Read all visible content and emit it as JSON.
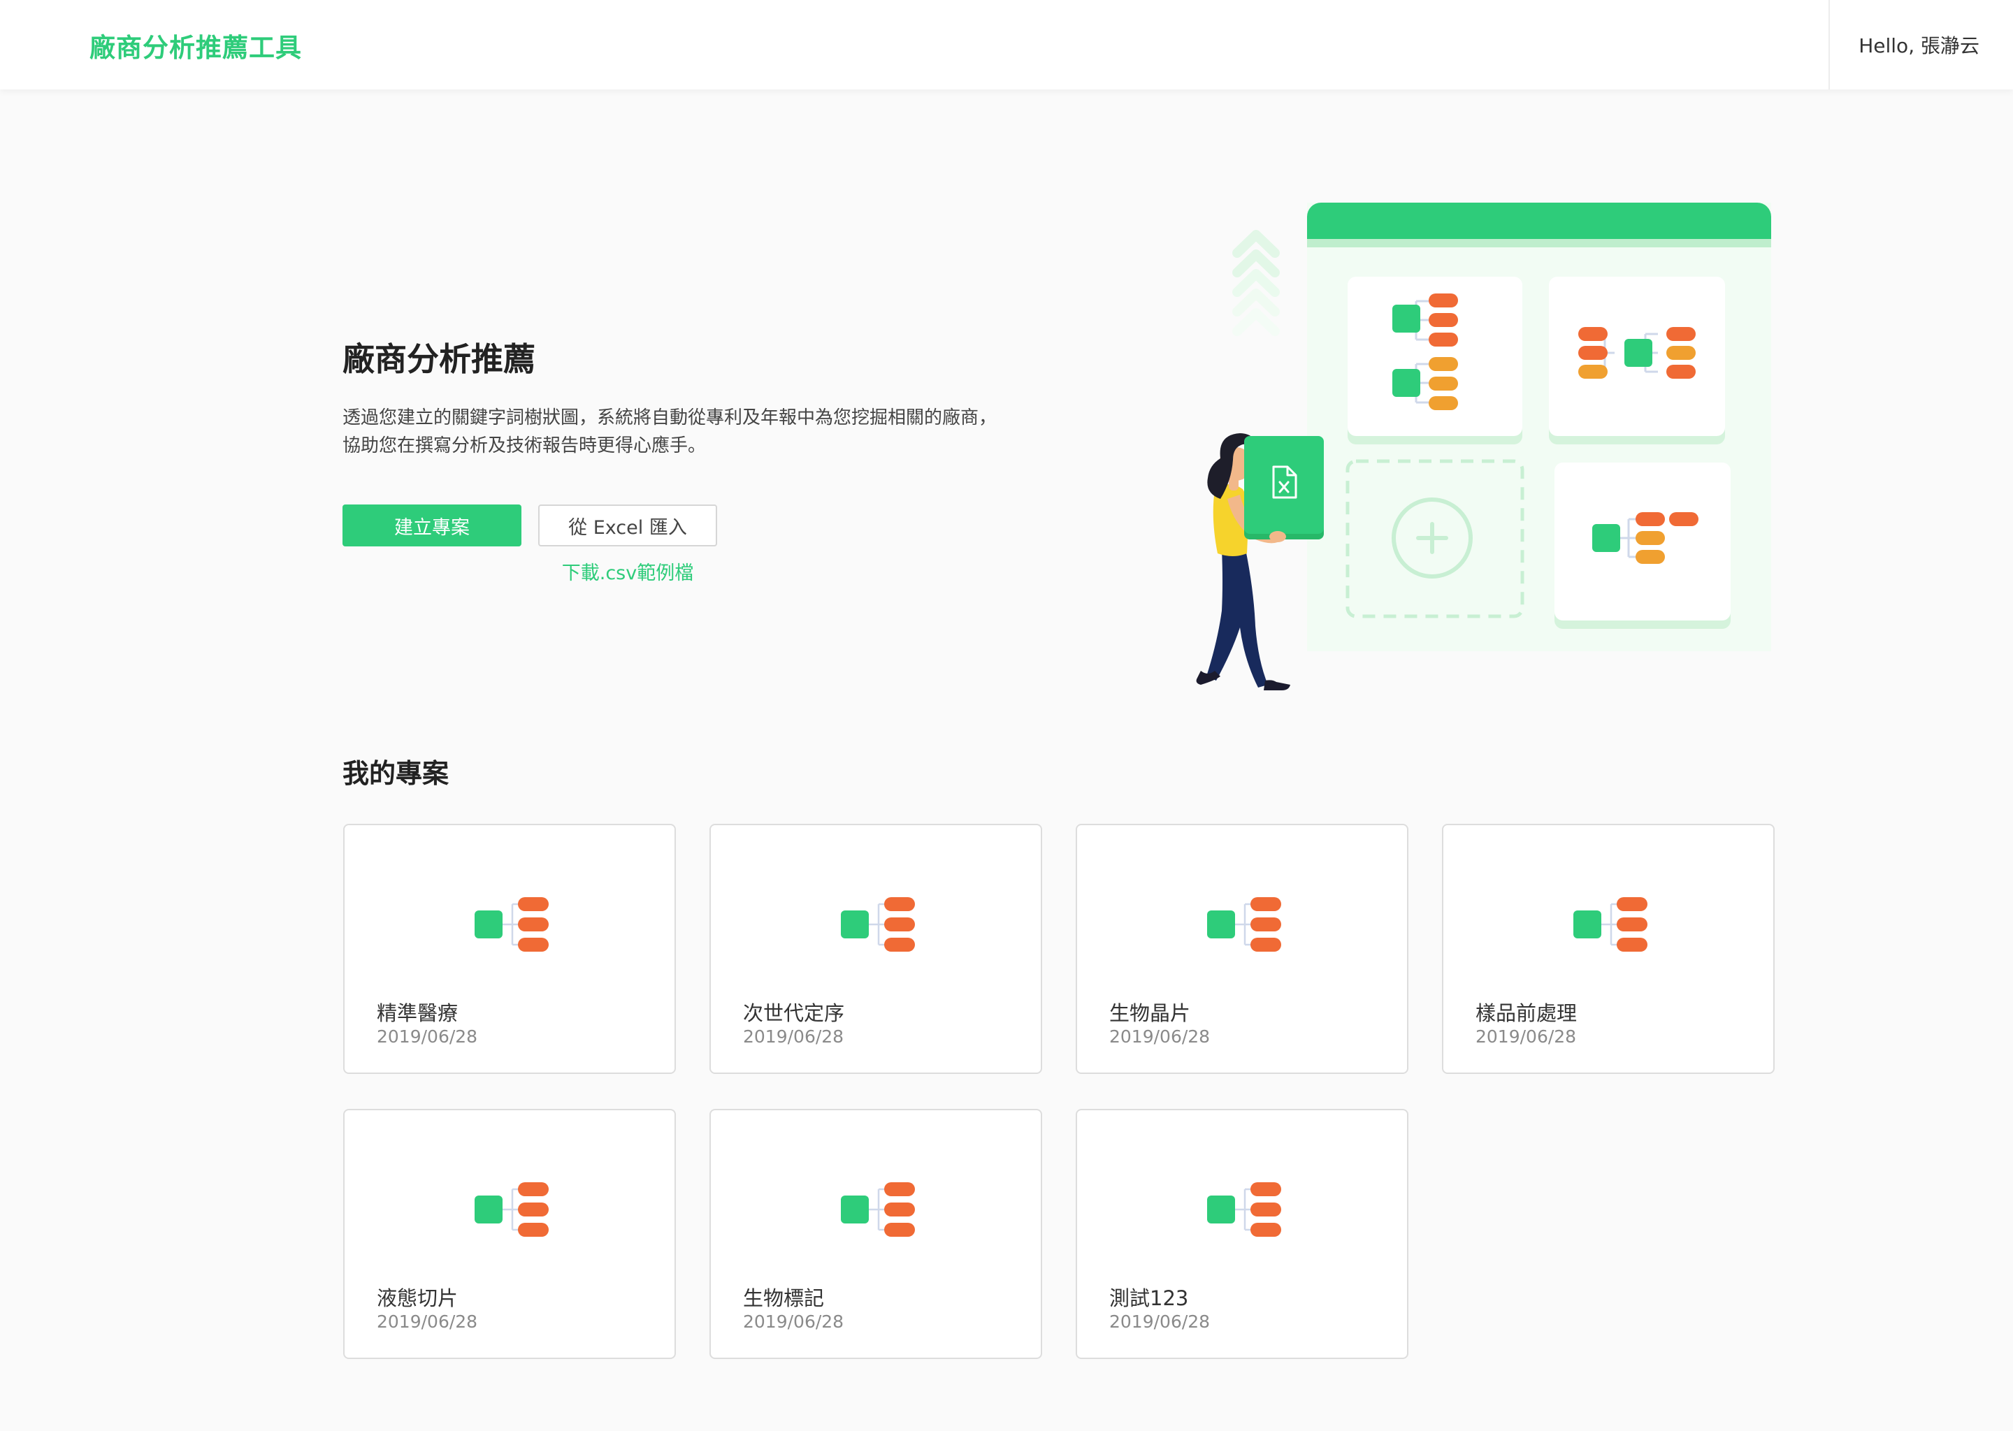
{
  "header": {
    "app_title": "廠商分析推薦工具",
    "greeting": "Hello, 張瀞云"
  },
  "hero": {
    "title": "廠商分析推薦",
    "description_line1": "透過您建立的關鍵字詞樹狀圖，系統將自動從專利及年報中為您挖掘相關的廠商，",
    "description_line2": "協助您在撰寫分析及技術報告時更得心應手。",
    "create_button": "建立專案",
    "import_button": "從 Excel 匯入",
    "csv_link": "下載.csv範例檔"
  },
  "projects": {
    "section_title": "我的專案",
    "items": [
      {
        "name": "精準醫療",
        "date": "2019/06/28"
      },
      {
        "name": "次世代定序",
        "date": "2019/06/28"
      },
      {
        "name": "生物晶片",
        "date": "2019/06/28"
      },
      {
        "name": "樣品前處理",
        "date": "2019/06/28"
      },
      {
        "name": "液態切片",
        "date": "2019/06/28"
      },
      {
        "name": "生物標記",
        "date": "2019/06/28"
      },
      {
        "name": "測試123",
        "date": "2019/06/28"
      }
    ]
  },
  "icons": {
    "excel_file": "excel-file-icon",
    "add": "plus-circle-icon",
    "tree": "tree-diagram-icon"
  },
  "colors": {
    "brand_green": "#2ecc7a",
    "node_orange": "#f06a35",
    "node_amber": "#f0a030",
    "pale_green": "#f2fcf4"
  }
}
